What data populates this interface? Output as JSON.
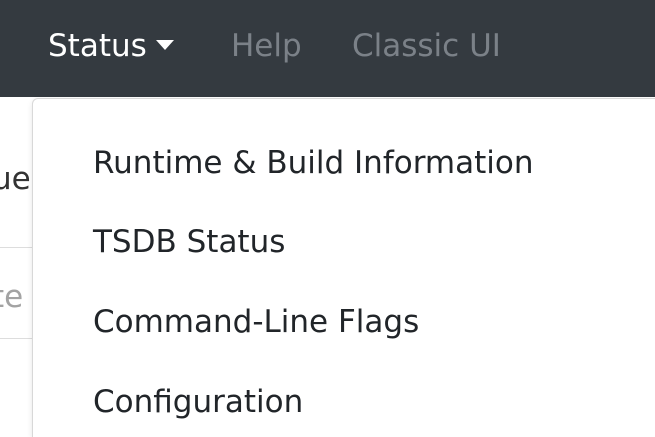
{
  "navbar": {
    "items": [
      {
        "label": "Status",
        "active": true,
        "has_caret": true
      },
      {
        "label": "Help",
        "active": false
      },
      {
        "label": "Classic UI",
        "active": false
      }
    ],
    "caret_icon": "caret-down-icon",
    "colors": {
      "background": "#343a40",
      "active_text": "#ffffff",
      "inactive_text": "#7b8188"
    }
  },
  "background_fragments": {
    "line1": "ue",
    "line2": "te"
  },
  "dropdown": {
    "items": [
      {
        "label": "Runtime & Build Information"
      },
      {
        "label": "TSDB Status"
      },
      {
        "label": "Command-Line Flags"
      },
      {
        "label": "Configuration"
      }
    ]
  }
}
